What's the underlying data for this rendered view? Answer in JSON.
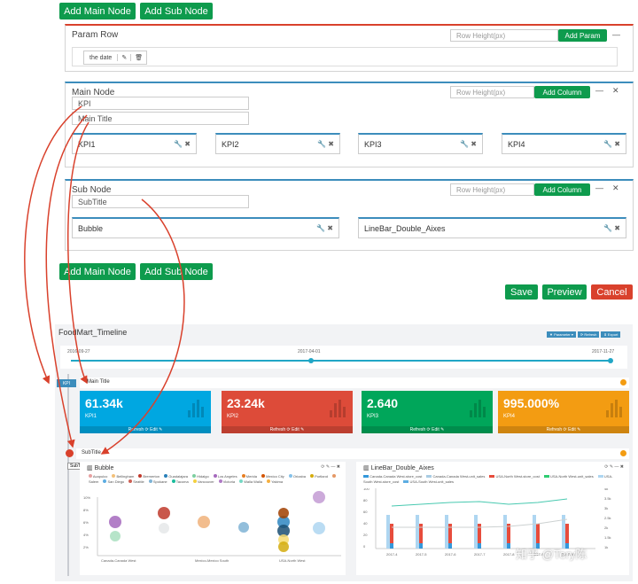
{
  "top_buttons": {
    "add_main": "Add Main Node",
    "add_sub": "Add Sub Node"
  },
  "param_row": {
    "title": "Param Row",
    "row_height_placeholder": "Row Height(px)",
    "add_label": "Add Param",
    "collapse": "—",
    "param_chip": "the date"
  },
  "main_node": {
    "title": "Main Node",
    "row_height_placeholder": "Row Height(px)",
    "add_label": "Add Column",
    "collapse": "—",
    "close": "✕",
    "field1": "KPI",
    "field2": "Main Title",
    "cards": [
      "KPI1",
      "KPI2",
      "KPI3",
      "KPI4"
    ]
  },
  "sub_node": {
    "title": "Sub Node",
    "row_height_placeholder": "Row Height(px)",
    "add_label": "Add Column",
    "collapse": "—",
    "close": "✕",
    "field1": "SubTitle",
    "cards": [
      "Bubble",
      "LineBar_Double_Aixes"
    ]
  },
  "bottom_buttons": {
    "add_main": "Add Main Node",
    "add_sub": "Add Sub Node"
  },
  "actions": {
    "save": "Save",
    "preview": "Preview",
    "cancel": "Cancel"
  },
  "preview": {
    "title": "FoodMart_Timeline",
    "toolbar": {
      "parameter": "▼ Parameter ▾",
      "refresh": "⟳ Refresh",
      "export": "⬇ Export"
    },
    "timeline": {
      "start": "2016-09-27",
      "mid": "2017-04-01",
      "end": "2017-11-27",
      "progress": 1.0
    },
    "kpi_tag": "KPI",
    "main_title": "Main Title",
    "sub_title": "SubTitle",
    "subtitle_tooltip": "SubTitle",
    "kpis": [
      {
        "value": "61.34k",
        "label": "KPI1",
        "color": "#00a7e1"
      },
      {
        "value": "23.24k",
        "label": "KPI2",
        "color": "#dd4b39"
      },
      {
        "value": "2.640",
        "label": "KPI3",
        "color": "#00a65a"
      },
      {
        "value": "995.000%",
        "label": "KPI4",
        "color": "#f39c12"
      }
    ],
    "kpi_footer": "Refresh ⟳ Edit ✎",
    "bubble_title": "Bubble",
    "linebar_title": "LineBar_Double_Aixes",
    "bubble_legend": [
      "Acapulco",
      "Bellingham",
      "Bremerton",
      "Guadalajara",
      "Hidalgo",
      "Los Angeles",
      "Merida",
      "Mexico City",
      "Orizaba",
      "Portland",
      "Salem",
      "San Diego",
      "Seattle",
      "Spokane",
      "Tacoma",
      "Vancouver",
      "Victoria",
      "Walla Walla",
      "Yakima"
    ],
    "bubble_x": [
      "Canada-Canada West",
      "Mexico-Mexico South",
      "USA-North West"
    ],
    "linebar_legend": [
      "Canada-Canada West-store_cost",
      "Canada-Canada West-unit_sales",
      "USA-North West-store_cost",
      "USA-North West-unit_sales",
      "USA-South West-store_cost",
      "USA-South West-unit_sales"
    ],
    "linebar_x": [
      "2017-4",
      "2017-5",
      "2017-6",
      "2017-7",
      "2017-8",
      "2017-9",
      "2017-10"
    ],
    "watermark": "知乎 @Tery陈"
  }
}
